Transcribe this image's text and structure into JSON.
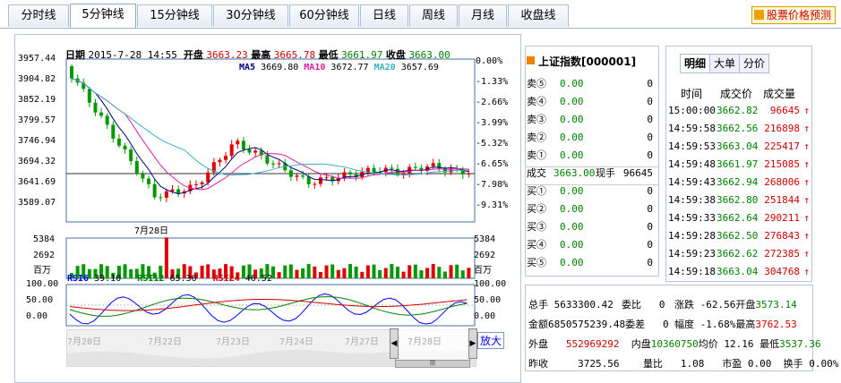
{
  "tabs": [
    {
      "label": "分时线",
      "active": false
    },
    {
      "label": "5分钟线",
      "active": true
    },
    {
      "label": "15分钟线",
      "active": false
    },
    {
      "label": "30分钟线",
      "active": false
    },
    {
      "label": "60分钟线",
      "active": false
    },
    {
      "label": "日线",
      "active": false
    },
    {
      "label": "周线",
      "active": false
    },
    {
      "label": "月线",
      "active": false
    },
    {
      "label": "收盘线",
      "active": false
    }
  ],
  "predict_label": "股票价格预测",
  "header": {
    "date_label": "日期",
    "date": "2015-7-28 14:55",
    "open_label": "开盘",
    "open": "3663.23",
    "high_label": "最高",
    "high": "3665.78",
    "low_label": "最低",
    "low": "3661.97",
    "close_label": "收盘",
    "close": "3663.00"
  },
  "ma": {
    "ma5_label": "MA5",
    "ma5": "3669.80",
    "ma10_label": "MA10",
    "ma10": "3672.77",
    "ma20_label": "MA20",
    "ma20": "3657.69"
  },
  "price_axis": [
    "3957.44",
    "3904.82",
    "3852.19",
    "3799.57",
    "3746.94",
    "3694.32",
    "3641.69",
    "3589.07"
  ],
  "pct_axis": [
    "0.00%",
    "-1.33%",
    "-2.66%",
    "-3.99%",
    "-5.32%",
    "-6.65%",
    "-7.98%",
    "-9.31%"
  ],
  "date_marker": "7月28日",
  "vol_axis": {
    "top": "5384",
    "mid": "2692",
    "unit": "百万"
  },
  "rsi": {
    "axis": [
      "100.00",
      "50.00",
      "0.00"
    ],
    "rsi6_label": "RSI6",
    "rsi6": "39.10",
    "rsi12_label": "RSI12",
    "rsi12": "65.36",
    "rsi24_label": "RSI24",
    "rsi24": "46.52"
  },
  "timeline_dates": [
    "7月20日",
    "7月22日",
    "7月23日",
    "7月24日",
    "7月27日",
    "7月28日"
  ],
  "zoom_label": "放大",
  "colors": {
    "up": "#e00000",
    "down": "#009a00",
    "ma5": "#000080",
    "ma10": "#e0209a",
    "ma20": "#40b0c0"
  },
  "index": {
    "title": "上证指数[000001]",
    "sells": [
      {
        "label": "卖⑤",
        "price": "0.00",
        "qty": "0"
      },
      {
        "label": "卖④",
        "price": "0.00",
        "qty": "0"
      },
      {
        "label": "卖③",
        "price": "0.00",
        "qty": "0"
      },
      {
        "label": "卖②",
        "price": "0.00",
        "qty": "0"
      },
      {
        "label": "卖①",
        "price": "0.00",
        "qty": "0"
      }
    ],
    "deal": {
      "label": "成交",
      "price": "3663.00",
      "now_label": "现手",
      "qty": "96645"
    },
    "buys": [
      {
        "label": "买①",
        "price": "0.00",
        "qty": "0"
      },
      {
        "label": "买②",
        "price": "0.00",
        "qty": "0"
      },
      {
        "label": "买③",
        "price": "0.00",
        "qty": "0"
      },
      {
        "label": "买④",
        "price": "0.00",
        "qty": "0"
      },
      {
        "label": "买⑤",
        "price": "0.00",
        "qty": "0"
      }
    ]
  },
  "detail": {
    "tabs": [
      "明细",
      "大单",
      "分价"
    ],
    "headers": [
      "时间",
      "成交价",
      "成交量"
    ],
    "rows": [
      {
        "time": "15:00:00",
        "price": "3662.82",
        "vol": "96645"
      },
      {
        "time": "14:59:58",
        "price": "3662.56",
        "vol": "216898"
      },
      {
        "time": "14:59:53",
        "price": "3663.04",
        "vol": "225417"
      },
      {
        "time": "14:59:48",
        "price": "3661.97",
        "vol": "215085"
      },
      {
        "time": "14:59:43",
        "price": "3662.94",
        "vol": "268006"
      },
      {
        "time": "14:59:38",
        "price": "3662.80",
        "vol": "251844"
      },
      {
        "time": "14:59:33",
        "price": "3662.64",
        "vol": "290211"
      },
      {
        "time": "14:59:28",
        "price": "3662.50",
        "vol": "276843"
      },
      {
        "time": "14:59:23",
        "price": "3662.62",
        "vol": "272385"
      },
      {
        "time": "14:59:18",
        "price": "3663.04",
        "vol": "304768"
      }
    ]
  },
  "stats": {
    "total_hands_label": "总手",
    "total_hands": "5633300.42",
    "wei_bi_label": "委比",
    "wei_bi": "0",
    "change_label": "涨跌",
    "change": "-62.56",
    "open_label": "开盘",
    "open": "3573.14",
    "amount_label": "金额",
    "amount": "6850575239.48",
    "wei_cha_label": "委差",
    "wei_cha": "0",
    "range_label": "幅度",
    "range": "-1.68%",
    "high_label": "最高",
    "high": "3762.53",
    "outer_label": "外盘",
    "outer": "552969292",
    "inner_label": "内盘",
    "inner": "10360750",
    "avg_label": "均价",
    "avg": "12.16",
    "low_label": "最低",
    "low": "3537.36",
    "prev_label": "昨收",
    "prev": "3725.56",
    "ratio_label": "量比",
    "ratio": "1.08",
    "pe_label": "市盈",
    "pe": "0.00",
    "turnover_label": "换手",
    "turnover": "0.00%"
  }
}
